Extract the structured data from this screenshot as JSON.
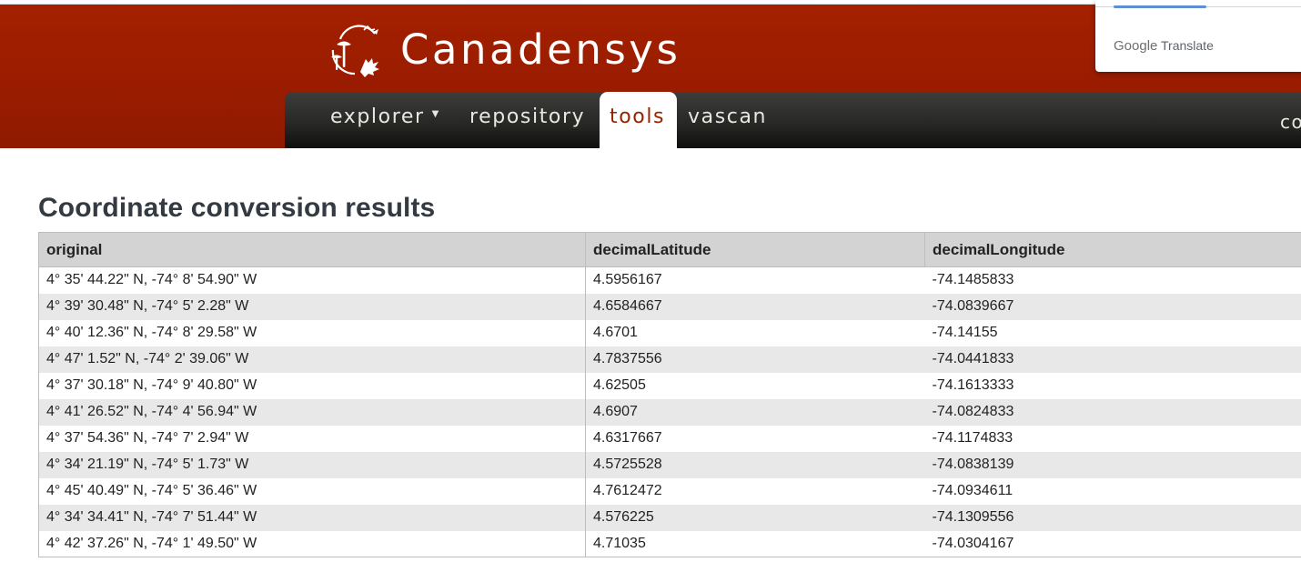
{
  "brand": {
    "name": "Canadensys",
    "logo_icon": "canadensys-logo-mushroom-leaf-icon"
  },
  "nav": {
    "items": [
      {
        "label": "explorer",
        "has_dropdown": true,
        "icon": "caret-down-icon"
      },
      {
        "label": "repository"
      },
      {
        "label": "tools",
        "active": true
      },
      {
        "label": "vascan"
      }
    ],
    "cut_item": "co"
  },
  "google_translate": {
    "label": "Translate",
    "logo_text": "Google"
  },
  "page": {
    "title": "Coordinate conversion results"
  },
  "table": {
    "headers": [
      "original",
      "decimalLatitude",
      "decimalLongitude"
    ],
    "rows": [
      [
        "4° 35' 44.22\" N, -74° 8' 54.90\" W",
        "4.5956167",
        "-74.1485833"
      ],
      [
        "4° 39' 30.48\" N, -74° 5' 2.28\" W",
        "4.6584667",
        "-74.0839667"
      ],
      [
        "4° 40' 12.36\" N, -74° 8' 29.58\" W",
        "4.6701",
        "-74.14155"
      ],
      [
        "4° 47' 1.52\" N, -74° 2' 39.06\" W",
        "4.7837556",
        "-74.0441833"
      ],
      [
        "4° 37' 30.18\" N, -74° 9' 40.80\" W",
        "4.62505",
        "-74.1613333"
      ],
      [
        "4° 41' 26.52\" N, -74° 4' 56.94\" W",
        "4.6907",
        "-74.0824833"
      ],
      [
        "4° 37' 54.36\" N, -74° 7' 2.94\" W",
        "4.6317667",
        "-74.1174833"
      ],
      [
        "4° 34' 21.19\" N, -74° 5' 1.73\" W",
        "4.5725528",
        "-74.0838139"
      ],
      [
        "4° 45' 40.49\" N, -74° 5' 36.46\" W",
        "4.7612472",
        "-74.0934611"
      ],
      [
        "4° 34' 34.41\" N, -74° 7' 51.44\" W",
        "4.576225",
        "-74.1309556"
      ],
      [
        "4° 42' 37.26\" N, -74° 1' 49.50\" W",
        "4.71035",
        "-74.0304167"
      ]
    ]
  },
  "colors": {
    "header_red": "#9a1c00",
    "nav_dark": "#262624",
    "active_tab_text": "#9a2100",
    "table_header_bg": "#d3d3d3",
    "row_stripe": "#e8e8e8"
  }
}
